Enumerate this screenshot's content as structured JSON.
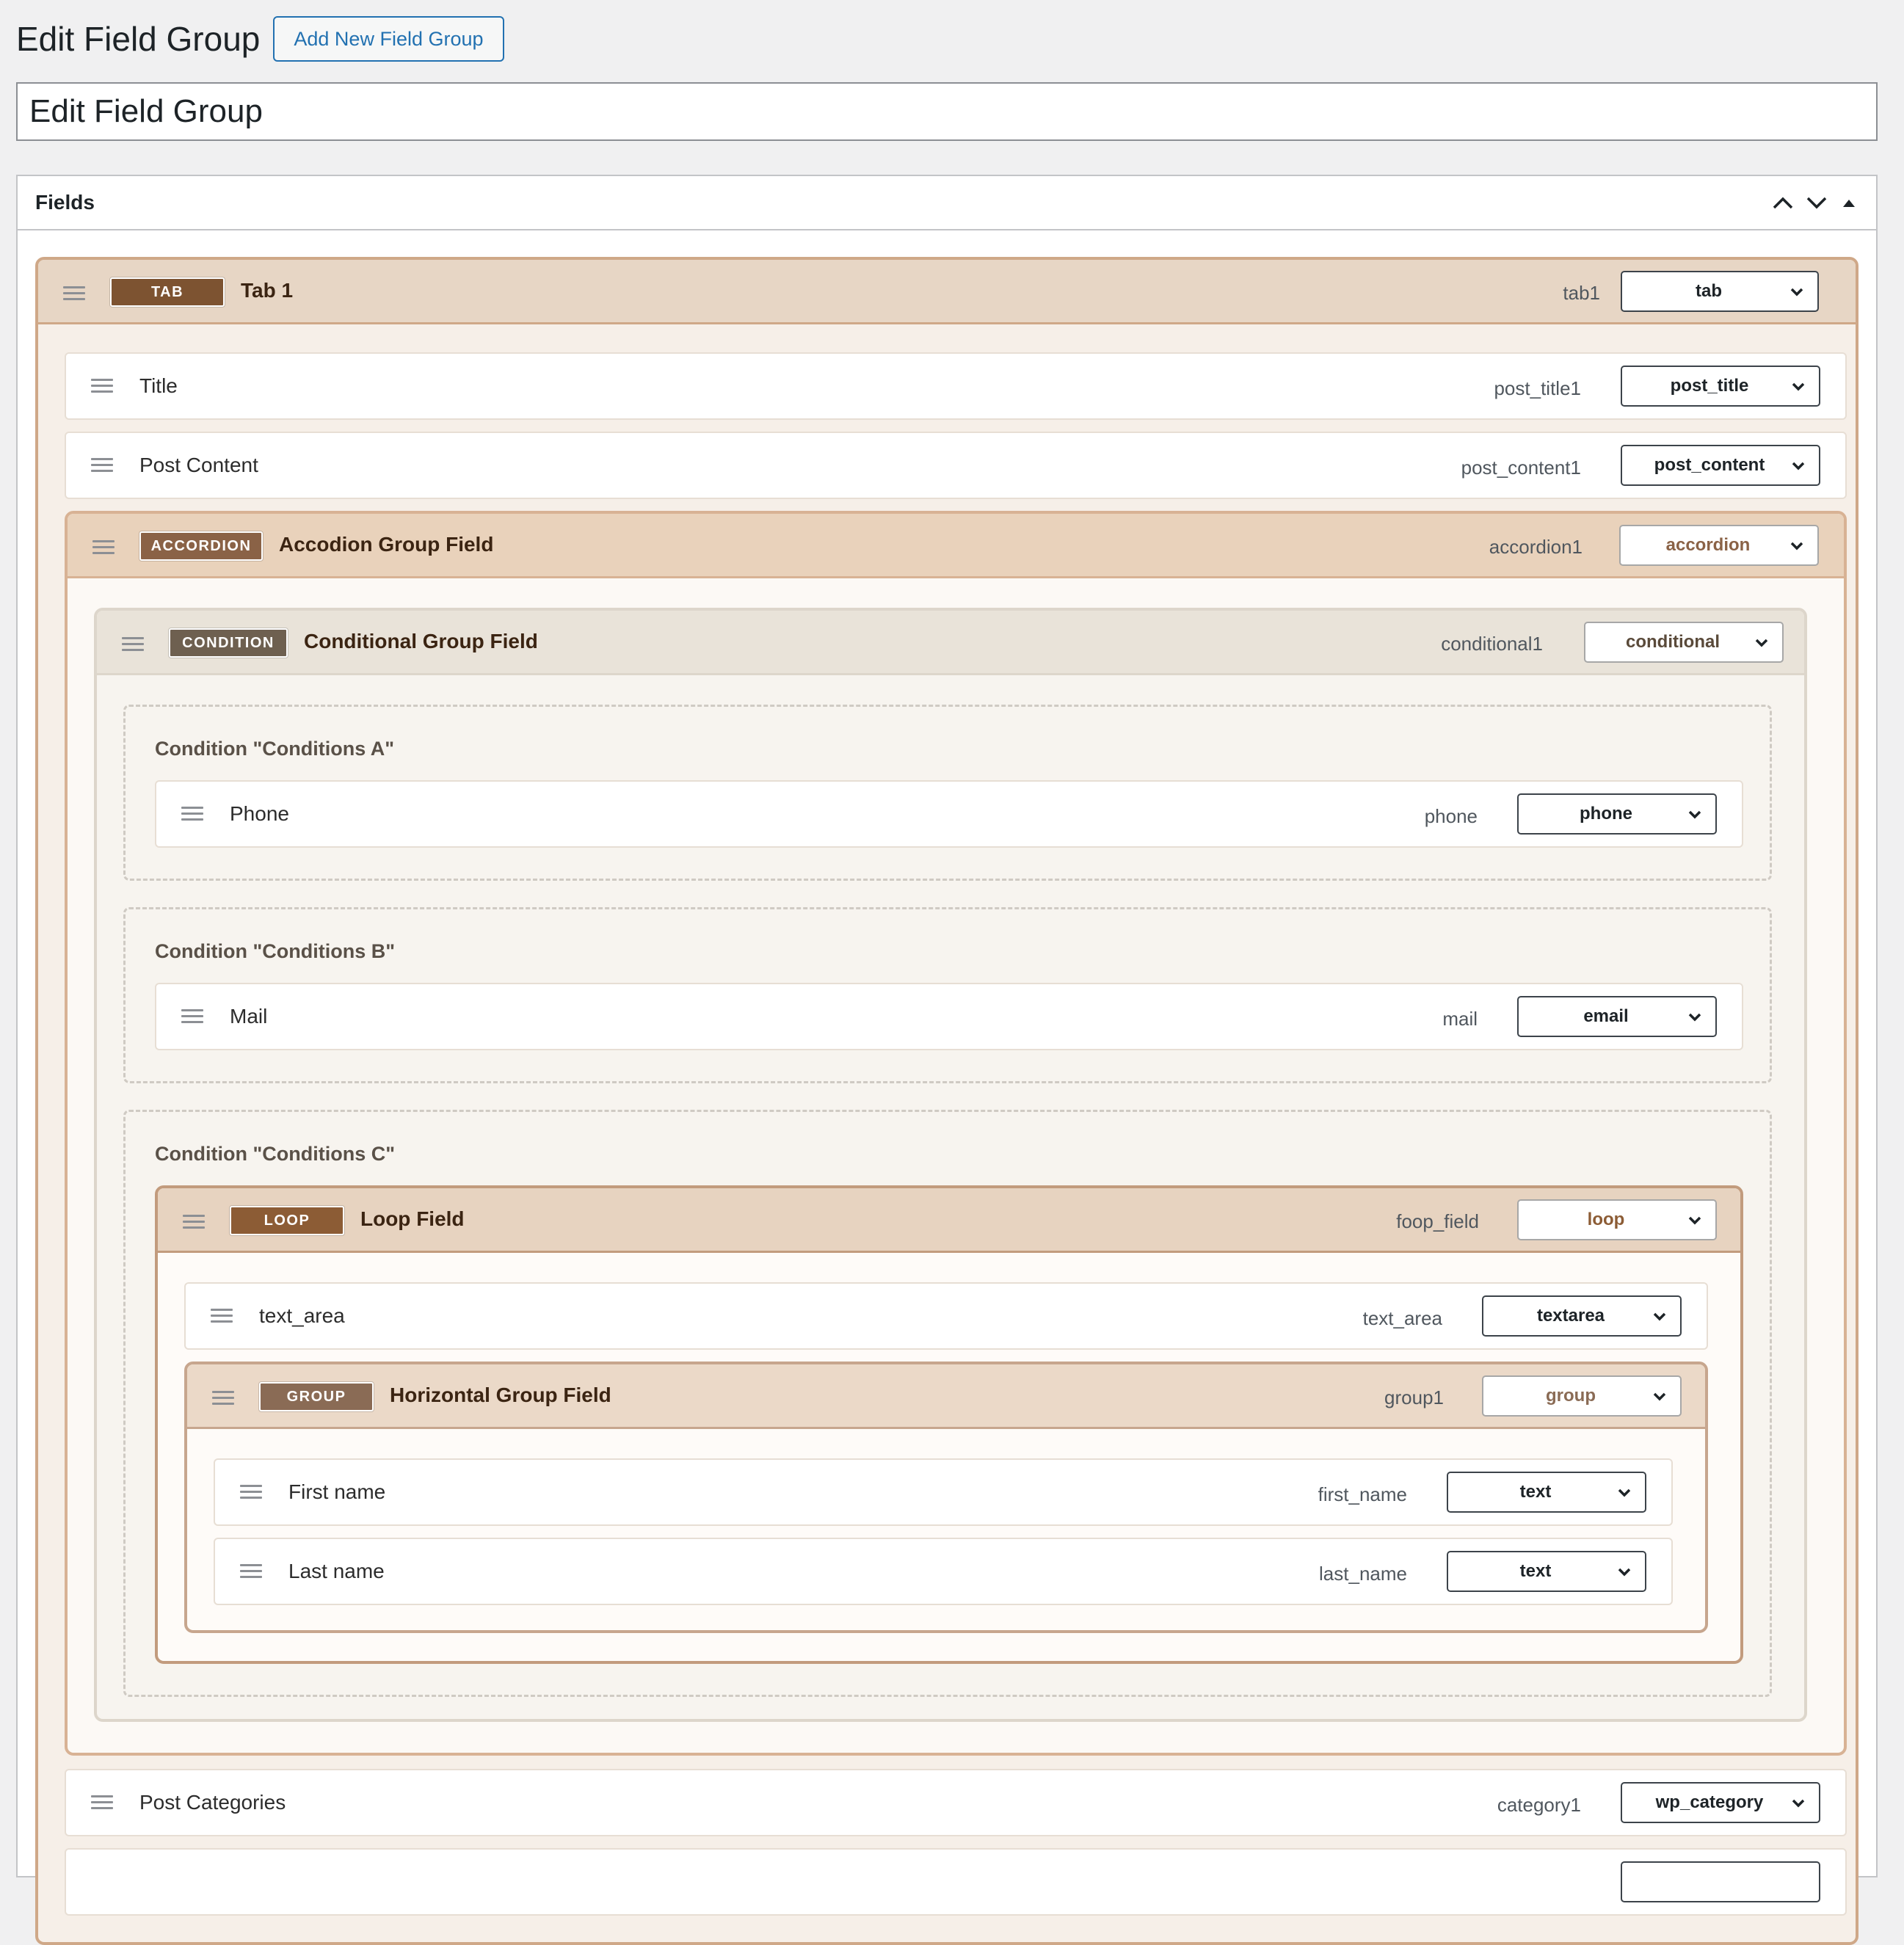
{
  "page": {
    "title": "Edit Field Group",
    "add_new_button": "Add New Field Group",
    "title_input_value": "Edit Field Group"
  },
  "panel": {
    "title": "Fields",
    "controls": [
      "chevron-up-icon",
      "chevron-down-icon",
      "triangle-up-icon"
    ]
  },
  "colors": {
    "accent": "#2271b1",
    "tab_badge": "#7d5331",
    "accordion_badge": "#8a6246",
    "condition_badge": "#6e6050",
    "loop_badge": "#8c5c35",
    "group_badge": "#8a6b55"
  },
  "fields": {
    "tab1": {
      "badge": "TAB",
      "label": "Tab 1",
      "key": "tab1",
      "type": "tab"
    },
    "title": {
      "label": "Title",
      "key": "post_title1",
      "type": "post_title"
    },
    "post_content": {
      "label": "Post Content",
      "key": "post_content1",
      "type": "post_content"
    },
    "accordion": {
      "badge": "ACCORDION",
      "label": "Accodion Group Field",
      "key": "accordion1",
      "type": "accordion"
    },
    "conditional": {
      "badge": "CONDITION",
      "label": "Conditional Group Field",
      "key": "conditional1",
      "type": "conditional"
    },
    "cond_a": {
      "title": "Condition \"Conditions A\""
    },
    "phone": {
      "label": "Phone",
      "key": "phone",
      "type": "phone"
    },
    "cond_b": {
      "title": "Condition \"Conditions B\""
    },
    "mail": {
      "label": "Mail",
      "key": "mail",
      "type": "email"
    },
    "cond_c": {
      "title": "Condition \"Conditions C\""
    },
    "loop": {
      "badge": "LOOP",
      "label": "Loop Field",
      "key": "foop_field",
      "type": "loop"
    },
    "text_area": {
      "label": "text_area",
      "key": "text_area",
      "type": "textarea"
    },
    "group": {
      "badge": "GROUP",
      "label": "Horizontal Group Field",
      "key": "group1",
      "type": "group"
    },
    "first_name": {
      "label": "First name",
      "key": "first_name",
      "type": "text"
    },
    "last_name": {
      "label": "Last name",
      "key": "last_name",
      "type": "text"
    },
    "categories": {
      "label": "Post Categories",
      "key": "category1",
      "type": "wp_category"
    }
  }
}
